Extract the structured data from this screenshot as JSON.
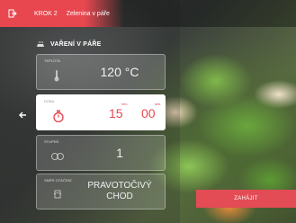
{
  "header": {
    "step": "KROK 2",
    "category": "Zelenina v páře"
  },
  "section_title": "VAŘENÍ V PÁŘE",
  "cards": {
    "temperature": {
      "label": "TEPLOTA",
      "value": "120 °C"
    },
    "time": {
      "label": "DOBA",
      "minutes": "15",
      "seconds": "00",
      "min_unit": "min.",
      "sec_unit": "sek."
    },
    "level": {
      "label": "STUPEŇ",
      "value": "1"
    },
    "rotation": {
      "label": "SMĚR OTÁČENÍ",
      "value_line1": "PRAVOTOČIVÝ",
      "value_line2": "CHOD"
    }
  },
  "start_button": "ZAHÁJIT",
  "colors": {
    "accent": "#e8474f"
  },
  "icons": {
    "exit": "exit-icon",
    "steam": "steam-icon",
    "thermometer": "thermometer-icon",
    "timer": "timer-icon",
    "speed": "speed-icon",
    "rotation": "rotation-icon",
    "back": "back-arrow-icon"
  }
}
